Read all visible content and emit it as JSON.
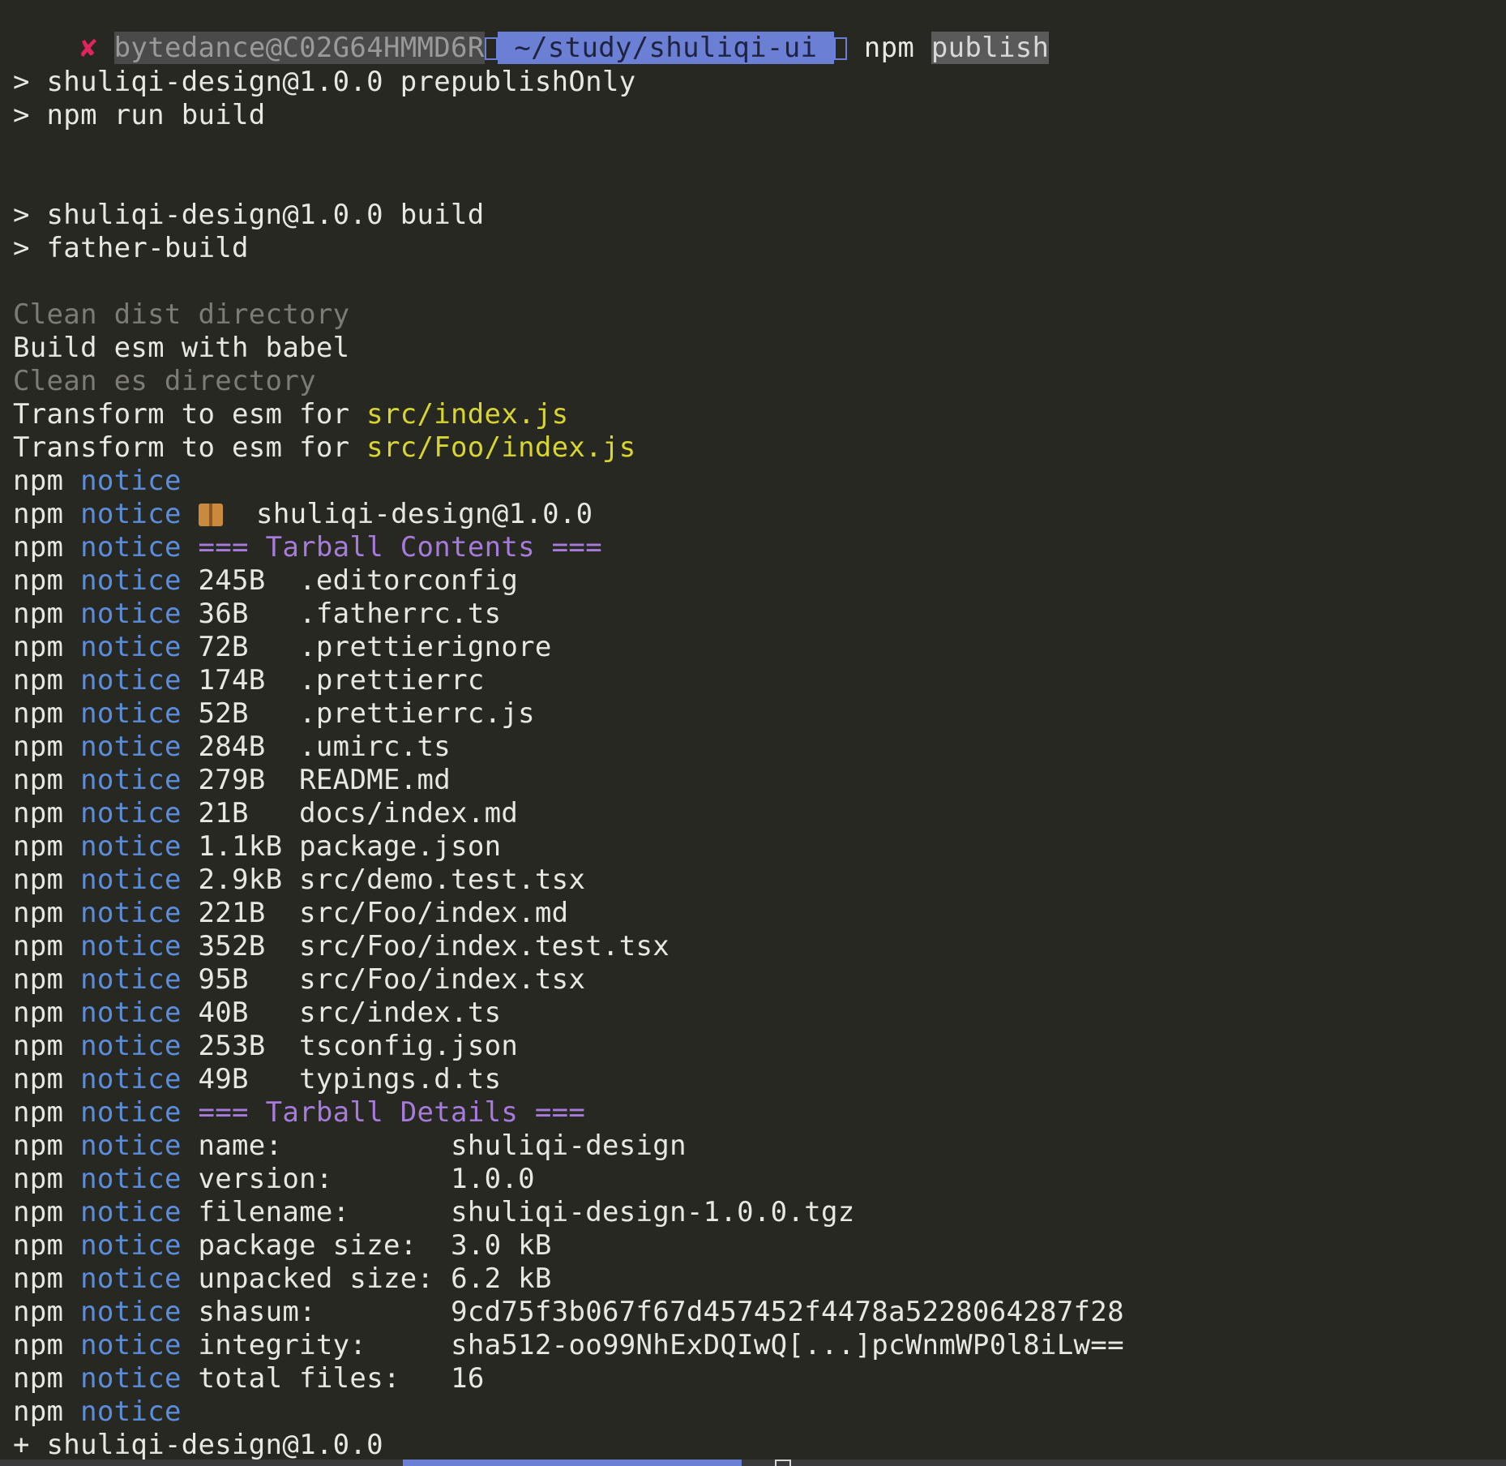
{
  "prompt": {
    "status_glyph": "✘",
    "host": "bytedance@C02G64HMMD6R",
    "path": "~/study/shuliqi-ui",
    "command": "npm",
    "command_arg": "publish"
  },
  "build": {
    "prepublish_1": "> shuliqi-design@1.0.0 prepublishOnly",
    "prepublish_2": "> npm run build",
    "build_1": "> shuliqi-design@1.0.0 build",
    "build_2": "> father-build",
    "clean_dist": "Clean dist directory",
    "build_esm": "Build esm with babel",
    "clean_es": "Clean es directory",
    "transform_prefix": "Transform to esm for ",
    "transform_files": [
      "src/index.js",
      "src/Foo/index.js"
    ]
  },
  "npm": {
    "prefix": "npm",
    "notice": "notice",
    "package_id": "shuliqi-design@1.0.0",
    "contents_header": "=== Tarball Contents ===",
    "details_header": "=== Tarball Details ===",
    "files": [
      {
        "size": "245B ",
        "name": ".editorconfig"
      },
      {
        "size": "36B  ",
        "name": ".fatherrc.ts"
      },
      {
        "size": "72B  ",
        "name": ".prettierignore"
      },
      {
        "size": "174B ",
        "name": ".prettierrc"
      },
      {
        "size": "52B  ",
        "name": ".prettierrc.js"
      },
      {
        "size": "284B ",
        "name": ".umirc.ts"
      },
      {
        "size": "279B ",
        "name": "README.md"
      },
      {
        "size": "21B  ",
        "name": "docs/index.md"
      },
      {
        "size": "1.1kB",
        "name": "package.json"
      },
      {
        "size": "2.9kB",
        "name": "src/demo.test.tsx"
      },
      {
        "size": "221B ",
        "name": "src/Foo/index.md"
      },
      {
        "size": "352B ",
        "name": "src/Foo/index.test.tsx"
      },
      {
        "size": "95B  ",
        "name": "src/Foo/index.tsx"
      },
      {
        "size": "40B  ",
        "name": "src/index.ts"
      },
      {
        "size": "253B ",
        "name": "tsconfig.json"
      },
      {
        "size": "49B  ",
        "name": "typings.d.ts"
      }
    ],
    "details": [
      {
        "key": "name:         ",
        "value": "shuliqi-design"
      },
      {
        "key": "version:      ",
        "value": "1.0.0"
      },
      {
        "key": "filename:     ",
        "value": "shuliqi-design-1.0.0.tgz"
      },
      {
        "key": "package size: ",
        "value": "3.0 kB"
      },
      {
        "key": "unpacked size:",
        "value": "6.2 kB"
      },
      {
        "key": "shasum:       ",
        "value": "9cd75f3b067f67d457452f4478a5228064287f28"
      },
      {
        "key": "integrity:    ",
        "value": "sha512-oo99NhExDQIwQ[...]pcWnmWP0l8iLw=="
      },
      {
        "key": "total files:  ",
        "value": "16"
      }
    ],
    "result": "+ shuliqi-design@1.0.0"
  },
  "colors": {
    "background": "#272822",
    "notice": "#5c8ddb",
    "header": "#a67bdc",
    "file_highlight": "#d7d52e",
    "path_segment": "#6b7fd4"
  }
}
